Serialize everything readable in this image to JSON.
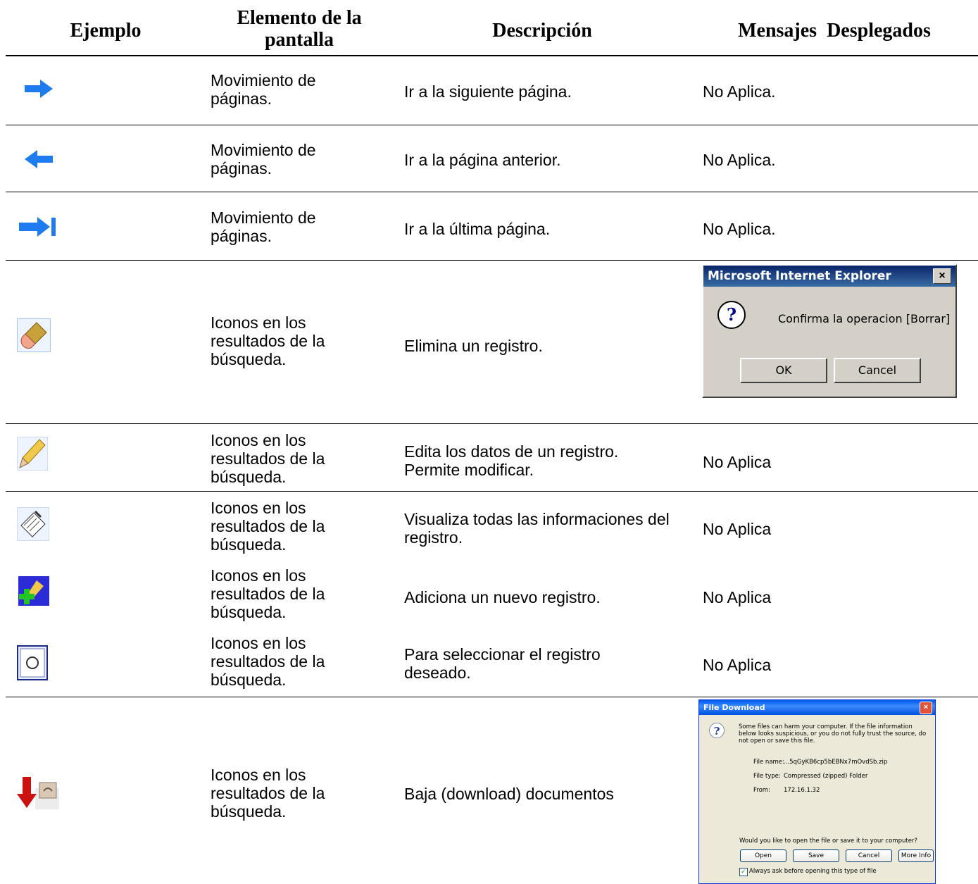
{
  "headers": {
    "ejemplo": "Ejemplo",
    "elemento": "Elemento de la pantalla",
    "descripcion": "Descripción",
    "mensajes": "Mensajes  Desplegados"
  },
  "rows": [
    {
      "icon": "arrow-right-icon",
      "elemento": "Movimiento de páginas.",
      "descripcion": "Ir a la siguiente página.",
      "mensajes": "No Aplica."
    },
    {
      "icon": "arrow-left-icon",
      "elemento": "Movimiento de páginas.",
      "descripcion": "Ir a la página anterior.",
      "mensajes": "No Aplica."
    },
    {
      "icon": "arrow-last-icon",
      "elemento": "Movimiento de páginas.",
      "descripcion": "Ir a la última página.",
      "mensajes": "No Aplica."
    },
    {
      "icon": "eraser-icon",
      "elemento": "Iconos en los resultados de la búsqueda.",
      "descripcion": "Elimina un registro.",
      "mensajes": ""
    },
    {
      "icon": "pencil-icon",
      "elemento": "Iconos en los resultados de la búsqueda.",
      "descripcion": "Edita los datos de un registro. Permite modificar.",
      "mensajes": "No Aplica"
    },
    {
      "icon": "view-icon",
      "elemento": "Iconos en los resultados de la búsqueda.",
      "descripcion": "Visualiza todas las informaciones del registro.",
      "mensajes": "No Aplica"
    },
    {
      "icon": "add-icon",
      "elemento": "Iconos en los resultados de la búsqueda.",
      "descripcion": "Adiciona un nuevo registro.",
      "mensajes": "No Aplica"
    },
    {
      "icon": "radio-icon",
      "elemento": "Iconos en los resultados de la búsqueda.",
      "descripcion": "Para seleccionar el registro deseado.",
      "mensajes": "No Aplica"
    },
    {
      "icon": "download-icon",
      "elemento": "Iconos en los resultados de la búsqueda.",
      "descripcion": "Baja (download) documentos",
      "mensajes": ""
    }
  ],
  "confirm_dialog": {
    "title": "Microsoft Internet Explorer",
    "close": "×",
    "message": "Confirma la operacion [Borrar]",
    "ok": "OK",
    "cancel": "Cancel"
  },
  "download_dialog": {
    "title": "File Download",
    "close": "×",
    "warning": "Some files can harm your computer. If the file information below looks suspicious, or you do not fully trust the source, do not open or save this file.",
    "file_name_label": "File name:",
    "file_name": "...5qGyKB6cp5bEBNx7mOvdSb.zip",
    "file_type_label": "File type:",
    "file_type": "Compressed (zipped) Folder",
    "from_label": "From:",
    "from": "172.16.1.32",
    "question": "Would you like to open the file or save it to your computer?",
    "open": "Open",
    "save": "Save",
    "cancel": "Cancel",
    "more_info": "More Info",
    "always_ask": "Always ask before opening this type of file",
    "always_ask_checked": true
  },
  "colors": {
    "arrow_blue": "#1e7bf0",
    "download_red": "#cc1111"
  }
}
